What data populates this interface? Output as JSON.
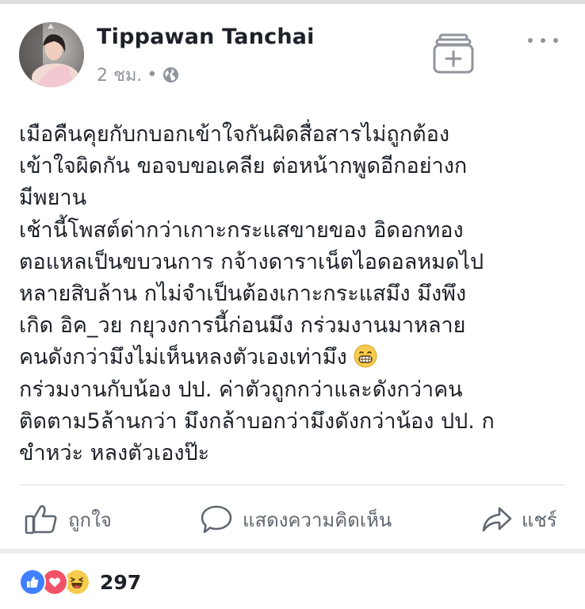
{
  "post": {
    "author": "Tippawan Tanchai",
    "time": "2 ชม.",
    "separator": "•",
    "lines": [
      "เมือคืนคุยกับกบอกเข้าใจกันผิดสื่อสารไม่ถูกต้อง",
      "เข้าใจผิดกัน ขอจบขอเคลีย ต่อหน้ากพูดอีกอย่างก",
      "มีพยาน",
      "เช้านี้โพสต์ด่ากว่าเกาะกระแสขายของ อิดอกทอง",
      "ตอแหลเป็นขบวนการ กจ้างดาราเน็ตไอดอลหมดไป",
      "หลายสิบล้าน กไม่จำเป็นต้องเกาะกระแสมึง มึงพึง",
      "เกิด อิค_วย กยุวงการนี้ก่อนมึง กร่วมงานมาหลาย",
      "คนดังกว่ามึงไม่เห็นหลงตัวเองเท่ามึง",
      "กร่วมงานกับน้อง ปป. ค่าตัวถูกกว่าและดังกว่าคน",
      "ติดตาม5ล้านกว่า มึงกล้าบอกว่ามึงดังกว่าน้อง ปป. ก",
      "ขำหว่ะ หลงตัวเองป๊ะ"
    ]
  },
  "actions": {
    "like": "ถูกใจ",
    "comment": "แสดงความคิดเห็น",
    "share": "แชร์"
  },
  "reactions": {
    "count": "297",
    "types": [
      "like",
      "love",
      "haha"
    ]
  },
  "colors": {
    "like_blue": "#4080ff",
    "love_red": "#f25268",
    "haha_yellow": "#f7cb4d",
    "meta_gray": "#90949c"
  }
}
